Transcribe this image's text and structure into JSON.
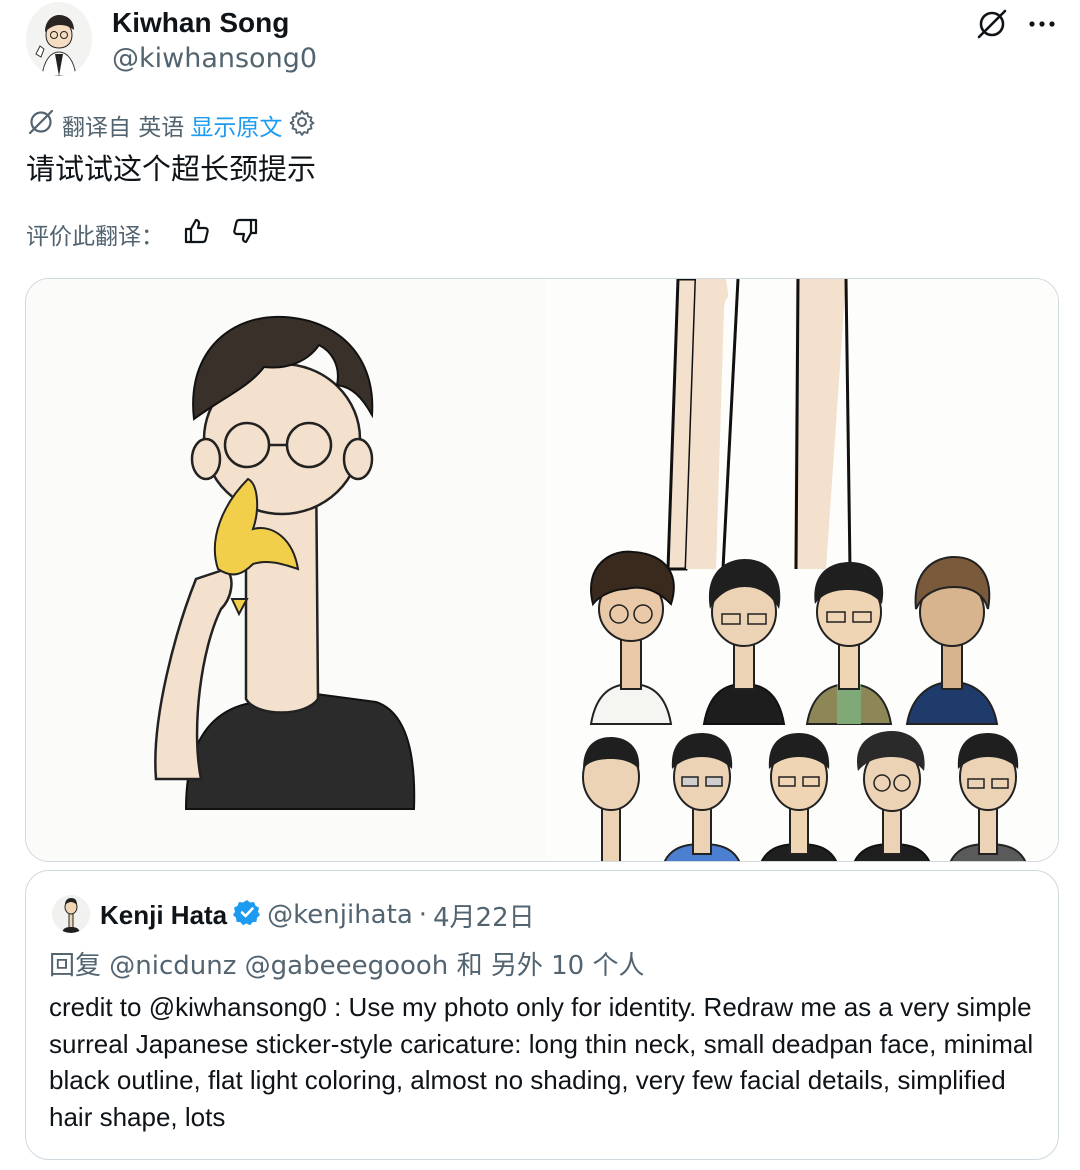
{
  "author": {
    "name": "Kiwhan Song",
    "handle": "@kiwhansong0"
  },
  "top_actions": {
    "translate_icon": "translate-slash-icon",
    "more_icon": "more-dots-icon"
  },
  "translation": {
    "translated_from": "翻译自 英语",
    "show_original": "显示原文",
    "settings_icon": "gear-icon"
  },
  "post": {
    "text": "请试试这个超长颈提示"
  },
  "rating": {
    "label": "评价此翻译：",
    "like_icon": "thumbs-up-icon",
    "dislike_icon": "thumbs-down-icon"
  },
  "media": {
    "description_icon": "image"
  },
  "quote": {
    "name": "Kenji Hata",
    "handle": "@kenjihata",
    "separator": "·",
    "date": "4月22日",
    "reply_prefix": "回复",
    "reply_mentions": "@nicdunz @gabeeegoooh",
    "reply_suffix": "和 另外 10 个人",
    "body": "credit to @kiwhansong0 : Use my photo only for identity. Redraw me as a very simple surreal Japanese sticker-style caricature: long thin neck, small deadpan face, minimal black outline, flat light coloring, almost no shading, very few facial details, simplified hair shape, lots"
  },
  "colors": {
    "link": "#1d9bf0",
    "muted": "#536471",
    "border": "#cfd9de",
    "verified": "#1d9bf0"
  }
}
